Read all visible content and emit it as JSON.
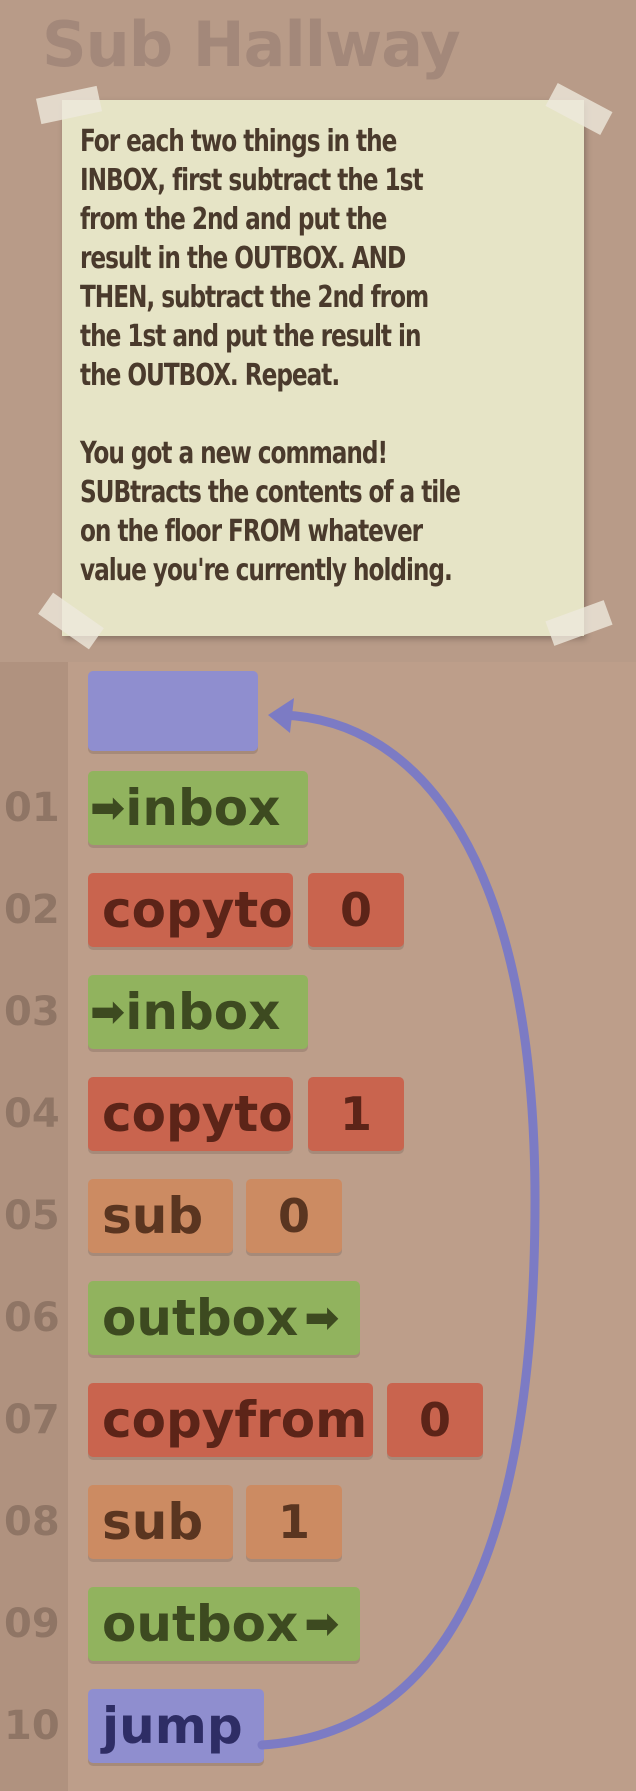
{
  "title": "Sub Hallway",
  "instructions": {
    "paragraph1_lines": [
      "For each two things in the",
      "INBOX, first subtract the 1st",
      "from the 2nd and put the",
      "result in the OUTBOX. AND",
      "THEN, subtract the 2nd from",
      "the 1st and put the result in",
      "the OUTBOX. Repeat."
    ],
    "paragraph2_lines": [
      "You got a new command!",
      "SUBtracts the contents of a tile",
      "on the floor FROM whatever",
      "value you're currently holding."
    ]
  },
  "program": [
    {
      "num": "01",
      "cmd": "inbox",
      "arrow_before": "➡",
      "arg": ""
    },
    {
      "num": "02",
      "cmd": "copyto",
      "arg": "0"
    },
    {
      "num": "03",
      "cmd": "inbox",
      "arrow_before": "➡",
      "arg": ""
    },
    {
      "num": "04",
      "cmd": "copyto",
      "arg": "1"
    },
    {
      "num": "05",
      "cmd": "sub",
      "arg": "0"
    },
    {
      "num": "06",
      "cmd": "outbox",
      "arrow_after": "➡",
      "arg": ""
    },
    {
      "num": "07",
      "cmd": "copyfrom",
      "arg": "0"
    },
    {
      "num": "08",
      "cmd": "sub",
      "arg": "1"
    },
    {
      "num": "09",
      "cmd": "outbox",
      "arrow_after": "➡",
      "arg": ""
    },
    {
      "num": "10",
      "cmd": "jump",
      "arg": ""
    }
  ],
  "colors": {
    "io": "#91b35e",
    "copy": "#c9644e",
    "math": "#cc8b62",
    "jump": "#8f8ecf"
  }
}
